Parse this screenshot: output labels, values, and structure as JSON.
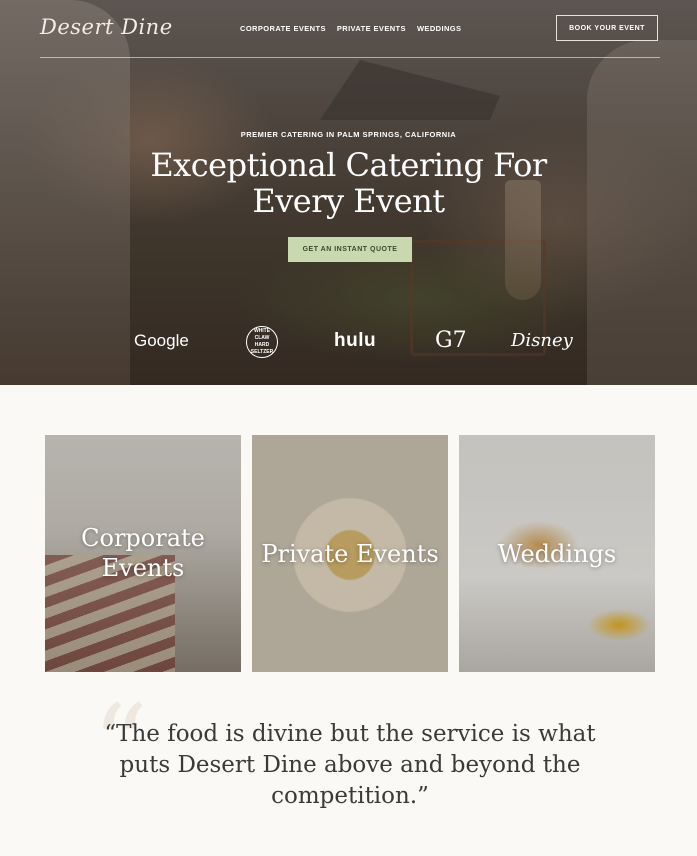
{
  "header": {
    "logo": "Desert Dine",
    "nav": [
      "CORPORATE EVENTS",
      "PRIVATE EVENTS",
      "WEDDINGS"
    ],
    "book_button": "BOOK YOUR EVENT"
  },
  "hero": {
    "eyebrow": "PREMIER CATERING IN PALM SPRINGS, CALIFORNIA",
    "headline_line1": "Exceptional Catering For",
    "headline_line2": "Every Event",
    "cta": "GET AN INSTANT QUOTE",
    "clients": {
      "google": "Google",
      "whiteclaw": "WHITE CLAW HARD SELTZER",
      "hulu": "hulu",
      "g7": "G7",
      "disney": "Disney"
    }
  },
  "services": [
    {
      "line1": "Corporate",
      "line2": "Events"
    },
    {
      "line1": "Private Events"
    },
    {
      "line1": "Weddings"
    }
  ],
  "testimonial": {
    "mark": "“",
    "text": "“The food is divine but the service is what puts Desert Dine above and beyond the competition.”"
  }
}
